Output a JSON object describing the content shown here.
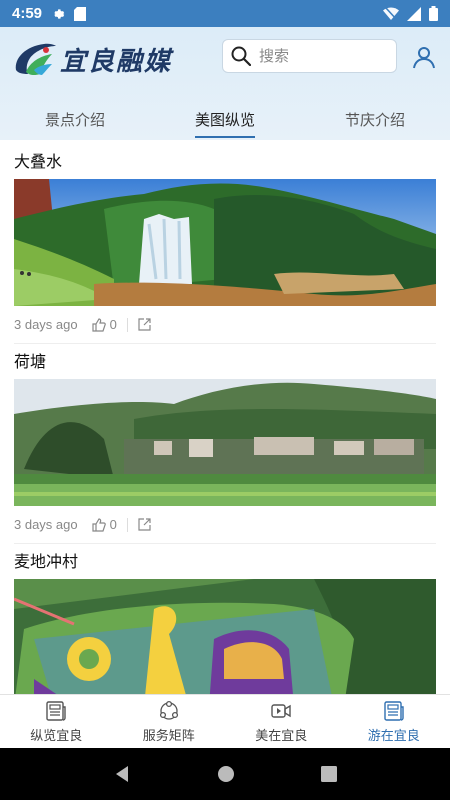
{
  "status_bar": {
    "time": "4:59"
  },
  "header": {
    "logo_text": "宜良融媒",
    "search": {
      "placeholder": "搜索"
    }
  },
  "tabs": [
    {
      "label": "景点介绍",
      "active": false
    },
    {
      "label": "美图纵览",
      "active": true
    },
    {
      "label": "节庆介绍",
      "active": false
    }
  ],
  "feed": {
    "items": [
      {
        "title": "大叠水",
        "time": "3 days ago",
        "likes": "0"
      },
      {
        "title": "荷塘",
        "time": "3 days ago",
        "likes": "0"
      },
      {
        "title": "麦地冲村"
      }
    ]
  },
  "bottom_nav": [
    {
      "label": "纵览宜良",
      "icon": "newspaper-icon",
      "active": false
    },
    {
      "label": "服务矩阵",
      "icon": "matrix-icon",
      "active": false
    },
    {
      "label": "美在宜良",
      "icon": "video-icon",
      "active": false
    },
    {
      "label": "游在宜良",
      "icon": "newspaper-icon",
      "active": true
    }
  ],
  "colors": {
    "status_bar": "#3c7fbf",
    "accent": "#2f6fb0",
    "header_bg": "#dcecf8"
  }
}
